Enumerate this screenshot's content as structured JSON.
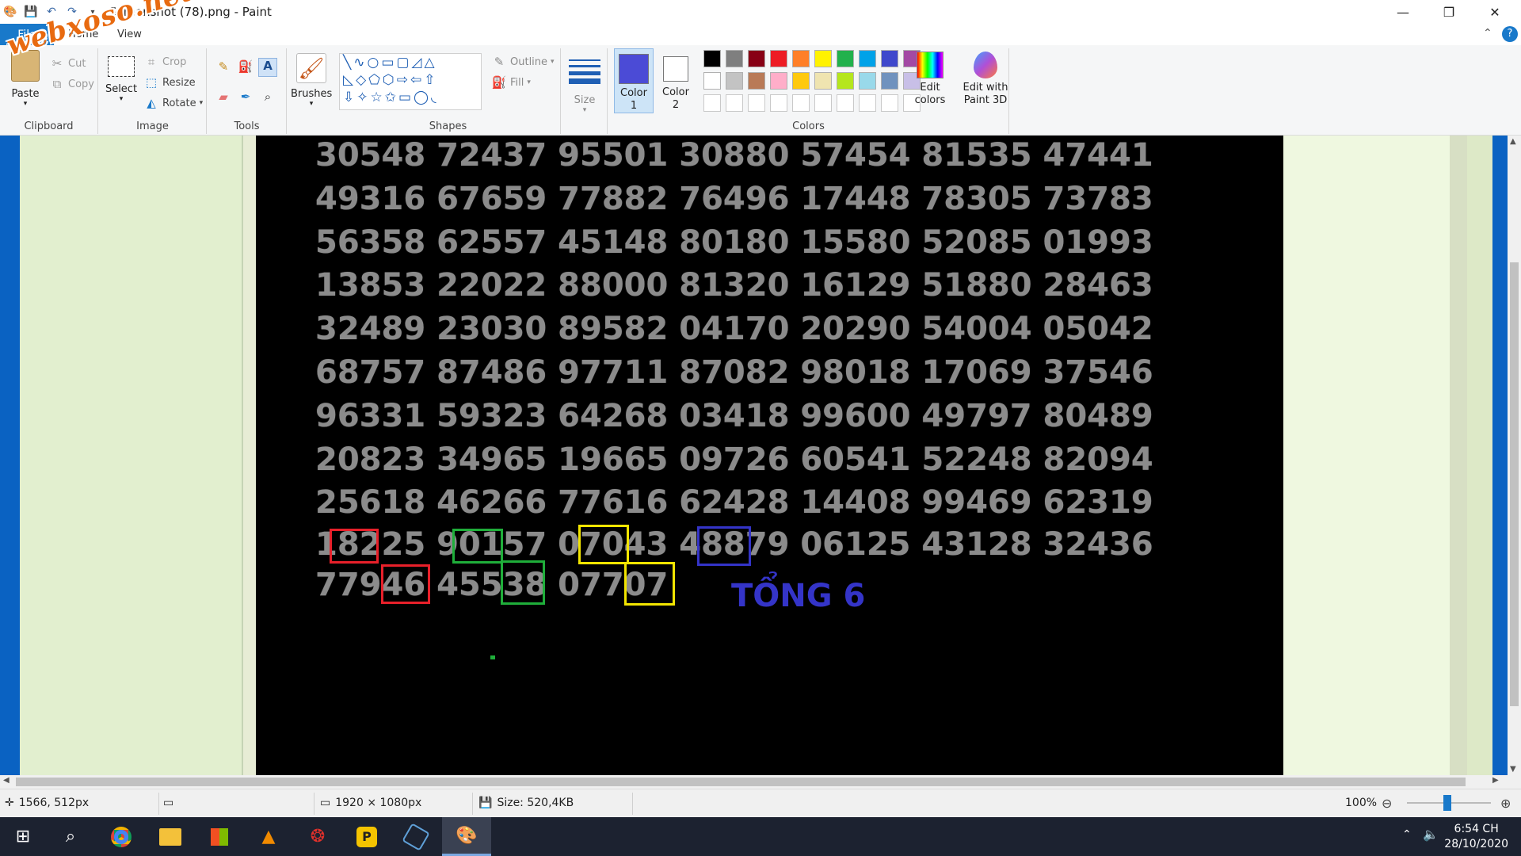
{
  "window": {
    "title": "Screenshot (78).png - Paint"
  },
  "watermark": "webxoso.net",
  "tabs": {
    "file": "File",
    "home": "Home",
    "view": "View"
  },
  "ribbon": {
    "clipboard": {
      "label": "Clipboard",
      "paste": "Paste",
      "cut": "Cut",
      "copy": "Copy"
    },
    "image": {
      "label": "Image",
      "select": "Select",
      "crop": "Crop",
      "resize": "Resize",
      "rotate": "Rotate"
    },
    "tools": {
      "label": "Tools"
    },
    "brushes": "Brushes",
    "shapes": {
      "label": "Shapes",
      "outline": "Outline",
      "fill": "Fill"
    },
    "size": "Size",
    "color1": "Color 1",
    "color2": "Color 2",
    "colors_label": "Colors",
    "edit_colors": "Edit colors",
    "edit_paint3d": "Edit with Paint 3D",
    "accent": "#4b4bd6",
    "palette_row1": [
      "#000000",
      "#7f7f7f",
      "#880015",
      "#ed1c24",
      "#ff7f27",
      "#fff200",
      "#22b14c",
      "#00a2e8",
      "#3f48cc",
      "#a349a4"
    ],
    "palette_row2": [
      "#ffffff",
      "#c3c3c3",
      "#b97a57",
      "#ffaec9",
      "#ffc90e",
      "#efe4b0",
      "#b5e61d",
      "#99d9ea",
      "#7092be",
      "#c8bfe7"
    ]
  },
  "canvas": {
    "rows": [
      "30548 72437 95501 30880 57454 81535 47441",
      "49316 67659 77882 76496 17448 78305 73783",
      "56358 62557 45148 80180 15580 52085 01993",
      "13853 22022 88000 81320 16129 51880 28463",
      "32489 23030 89582 04170 20290 54004 05042",
      "68757 87486 97711 87082 98018 17069 37546",
      "96331 59323 64268 03418 99600 49797 80489",
      "20823 34965 19665 09726 60541 52248 82094",
      "25618 46266 77616 62428 14408 99469 62319",
      "18225 90157 07043 48879 06125 43128 32436",
      "77946 45538 07707"
    ],
    "annotation": "TỔNG 6",
    "box_colors": {
      "red": "#e8202a",
      "green": "#1fae3a",
      "yellow": "#f2e500",
      "blue": "#3434c8"
    }
  },
  "status": {
    "cursor": "1566, 512px",
    "dimensions": "1920 × 1080px",
    "size": "Size: 520,4KB",
    "zoom": "100%"
  },
  "taskbar": {
    "apps": [
      "windows-start",
      "search",
      "chrome",
      "file-explorer",
      "store",
      "vlc",
      "garena",
      "app-yellow",
      "nox",
      "paint"
    ],
    "time": "6:54 CH",
    "date": "28/10/2020"
  }
}
